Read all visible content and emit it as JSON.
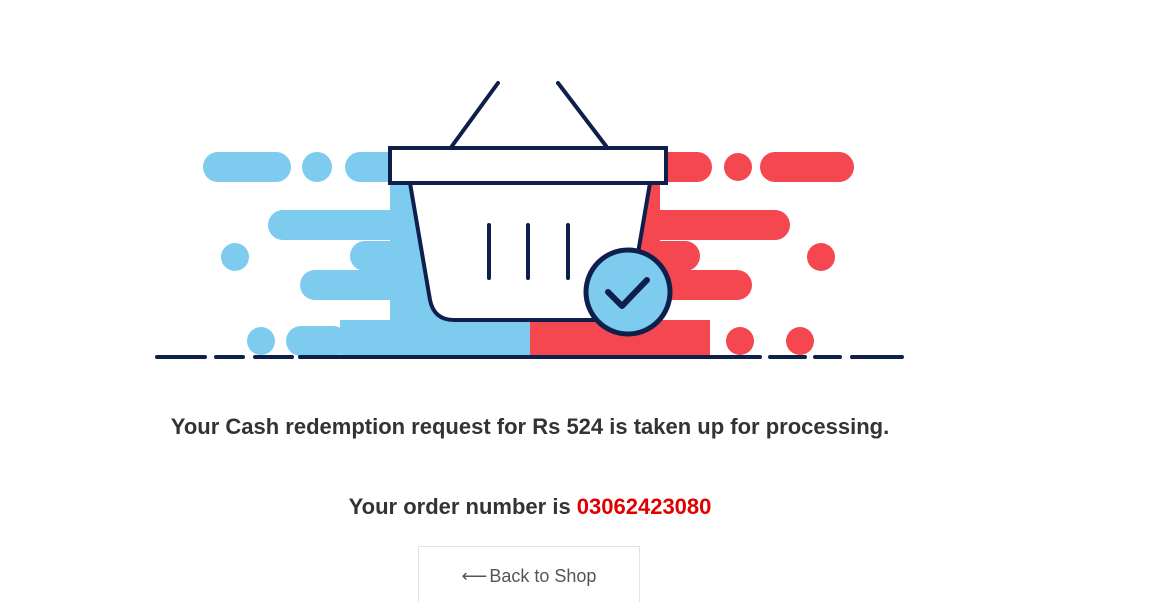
{
  "message": {
    "text": "Your Cash redemption request for Rs 524 is taken up for processing."
  },
  "order": {
    "prefix": "Your order number is ",
    "number": "03062423080"
  },
  "back_button": {
    "arrow": "⟵",
    "label": "Back to Shop"
  },
  "colors": {
    "blue": "#7ecbf0",
    "red": "#f4474f",
    "navy": "#0f1f4b",
    "order_number": "#e00000"
  },
  "illustration": {
    "icon": "shopping-basket-checkmark-icon"
  }
}
